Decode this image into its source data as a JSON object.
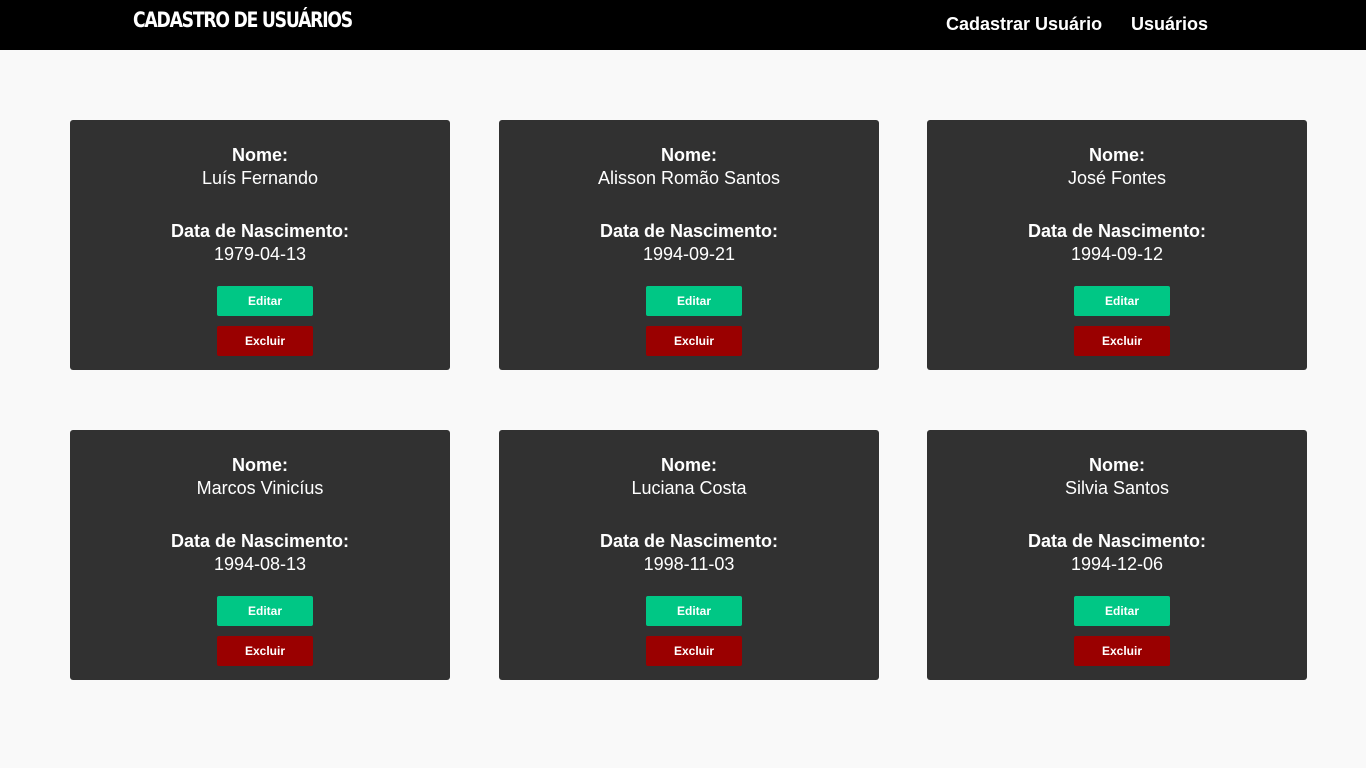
{
  "navbar": {
    "brand": "CADASTRO DE USUÁRIOS",
    "links": [
      "Cadastrar Usuário",
      "Usuários"
    ]
  },
  "colors": {
    "navbar_bg": "#000000",
    "page_bg": "#f9f9f9",
    "card_bg": "#313131",
    "edit_button": "#00c785",
    "delete_button": "#9a0000"
  },
  "labels": {
    "name": "Nome:",
    "birth_date": "Data de Nascimento:",
    "edit": "Editar",
    "delete": "Excluir"
  },
  "users": [
    {
      "name": "Luís Fernando",
      "birth_date": "1979-04-13"
    },
    {
      "name": "Alisson Romão Santos",
      "birth_date": "1994-09-21"
    },
    {
      "name": "José Fontes",
      "birth_date": "1994-09-12"
    },
    {
      "name": "Marcos Vinicíus",
      "birth_date": "1994-08-13"
    },
    {
      "name": "Luciana Costa",
      "birth_date": "1998-11-03"
    },
    {
      "name": "Silvia Santos",
      "birth_date": "1994-12-06"
    }
  ]
}
